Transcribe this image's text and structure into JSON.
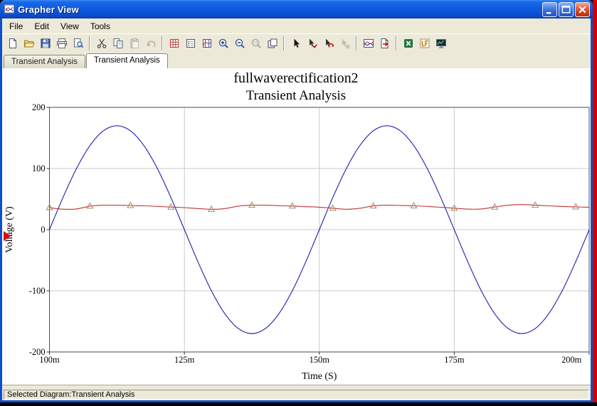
{
  "window": {
    "title": "Grapher View"
  },
  "menu": {
    "items": [
      "File",
      "Edit",
      "View",
      "Tools"
    ]
  },
  "toolbar": {
    "groups": [
      [
        {
          "name": "new"
        },
        {
          "name": "open"
        },
        {
          "name": "save"
        },
        {
          "name": "print"
        },
        {
          "name": "print-preview"
        }
      ],
      [
        {
          "name": "cut"
        },
        {
          "name": "copy"
        },
        {
          "name": "paste",
          "disabled": true
        },
        {
          "name": "undo",
          "disabled": true
        }
      ],
      [
        {
          "name": "show-grid"
        },
        {
          "name": "show-legend"
        },
        {
          "name": "show-cursors"
        },
        {
          "name": "zoom-in"
        },
        {
          "name": "zoom-out"
        },
        {
          "name": "zoom-area",
          "disabled": true
        },
        {
          "name": "zoom-full"
        }
      ],
      [
        {
          "name": "select-marks"
        },
        {
          "name": "apply-marks"
        },
        {
          "name": "revert-marks"
        },
        {
          "name": "clear-marks",
          "disabled": true
        }
      ],
      [
        {
          "name": "overlay-traces"
        },
        {
          "name": "export-page"
        }
      ],
      [
        {
          "name": "export-excel"
        },
        {
          "name": "export-labview"
        },
        {
          "name": "export-display"
        }
      ]
    ]
  },
  "tabs": [
    {
      "label": "Transient Analysis",
      "active": false
    },
    {
      "label": "Transient Analysis",
      "active": true
    }
  ],
  "status": {
    "text": "Selected Diagram:Transient Analysis"
  },
  "colors": {
    "titlebar_blue": "#0f5ae0",
    "desktop_red": "#d40000",
    "blue_trace": "#1c1cb0",
    "red_trace": "#c03434"
  },
  "chart_data": {
    "type": "line",
    "title": "fullwaverectification2",
    "subtitle": "Transient Analysis",
    "xlabel": "Time (S)",
    "ylabel": "Voltage (V)",
    "xlim": [
      0.1,
      0.2
    ],
    "ylim": [
      -200,
      200
    ],
    "grid": true,
    "legend": false,
    "x_ticks": [
      {
        "value": 0.1,
        "label": "100m"
      },
      {
        "value": 0.125,
        "label": "125m"
      },
      {
        "value": 0.15,
        "label": "150m"
      },
      {
        "value": 0.175,
        "label": "175m"
      },
      {
        "value": 0.2,
        "label": "200m"
      }
    ],
    "y_ticks": [
      {
        "value": 200,
        "label": "200"
      },
      {
        "value": 100,
        "label": "100"
      },
      {
        "value": 0,
        "label": "0"
      },
      {
        "value": -100,
        "label": "-100"
      },
      {
        "value": -200,
        "label": "-200"
      }
    ],
    "series": [
      {
        "name": "blue-trace",
        "color": "#1c1cb0",
        "x_start": 0.1,
        "x_step": 0.0025,
        "y": [
          0,
          52.5,
          99.9,
          137.5,
          161.7,
          170,
          161.7,
          137.5,
          99.9,
          52.5,
          0,
          -52.5,
          -99.9,
          -137.5,
          -161.7,
          -170,
          -161.7,
          -137.5,
          -99.9,
          -52.5,
          0,
          52.5,
          99.9,
          137.5,
          161.7,
          170,
          161.7,
          137.5,
          99.9,
          52.5,
          0,
          -52.5,
          -99.9,
          -137.5,
          -161.7,
          -170,
          -161.7,
          -137.5,
          -99.9,
          -52.5,
          0
        ]
      },
      {
        "name": "red-trace",
        "color": "#c03434",
        "marker": "triangle",
        "marker_every": 3,
        "marker_color": "#a58a62",
        "x_start": 0.1,
        "x_step": 0.0025,
        "y": [
          36,
          33.5,
          33.8,
          38.5,
          40,
          40,
          39.5,
          39,
          38,
          37,
          36,
          34.5,
          33.2,
          34.5,
          38.5,
          40,
          40,
          39.3,
          38.6,
          37.6,
          36.8,
          35,
          33.4,
          35,
          38.8,
          40,
          39.6,
          39,
          38,
          36.6,
          35,
          33.6,
          33.8,
          37,
          40,
          41,
          40,
          39,
          38,
          37.2,
          36.8
        ]
      }
    ]
  }
}
